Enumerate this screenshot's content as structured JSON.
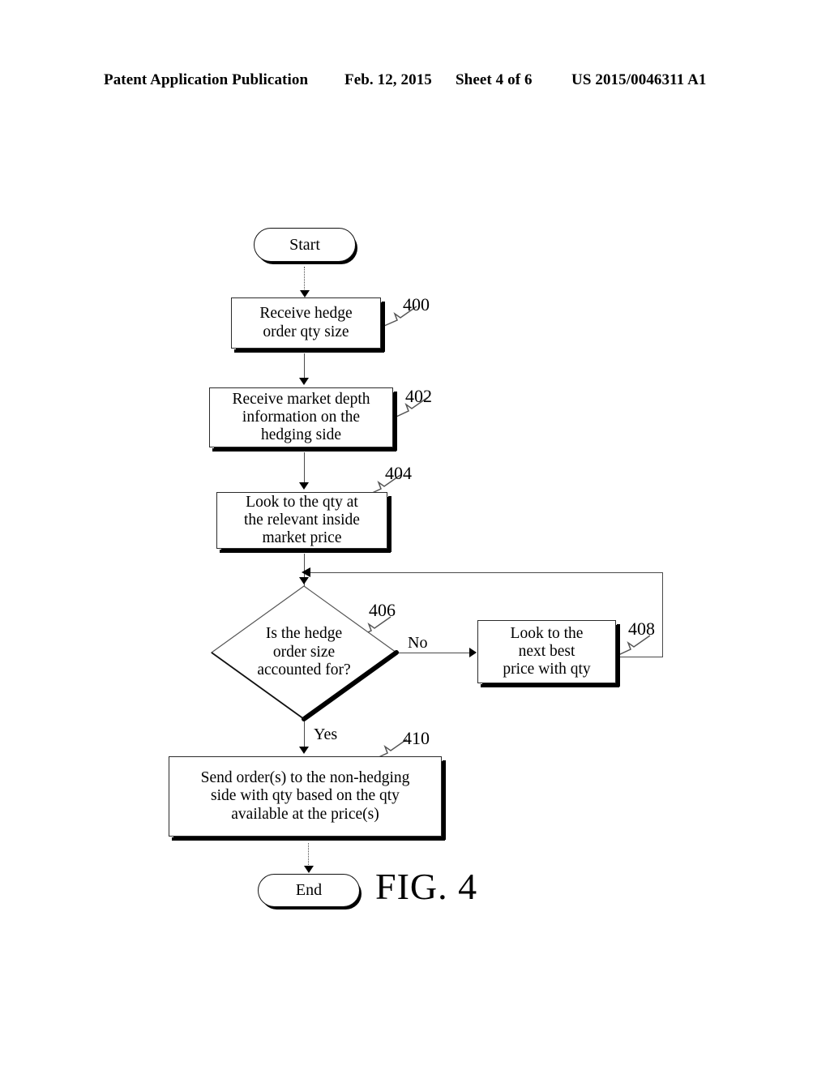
{
  "header": {
    "publication": "Patent Application Publication",
    "date": "Feb. 12, 2015",
    "sheet": "Sheet 4 of 6",
    "number": "US 2015/0046311 A1"
  },
  "figure": {
    "caption": "FIG. 4"
  },
  "flowchart": {
    "start": {
      "label": "Start"
    },
    "end": {
      "label": "End"
    },
    "steps": [
      {
        "ref": "400",
        "text": "Receive hedge\norder qty size"
      },
      {
        "ref": "402",
        "text": "Receive market depth\ninformation on the\nhedging side"
      },
      {
        "ref": "404",
        "text": "Look to the qty at\nthe relevant inside\nmarket price"
      },
      {
        "ref": "406",
        "text": "Is the hedge\norder size\naccounted for?"
      },
      {
        "ref": "408",
        "text": "Look to the\nnext best\nprice with qty"
      },
      {
        "ref": "410",
        "text": "Send order(s) to the non-hedging\nside with qty based on the qty\navailable at the price(s)"
      }
    ],
    "branches": {
      "no": "No",
      "yes": "Yes"
    }
  }
}
